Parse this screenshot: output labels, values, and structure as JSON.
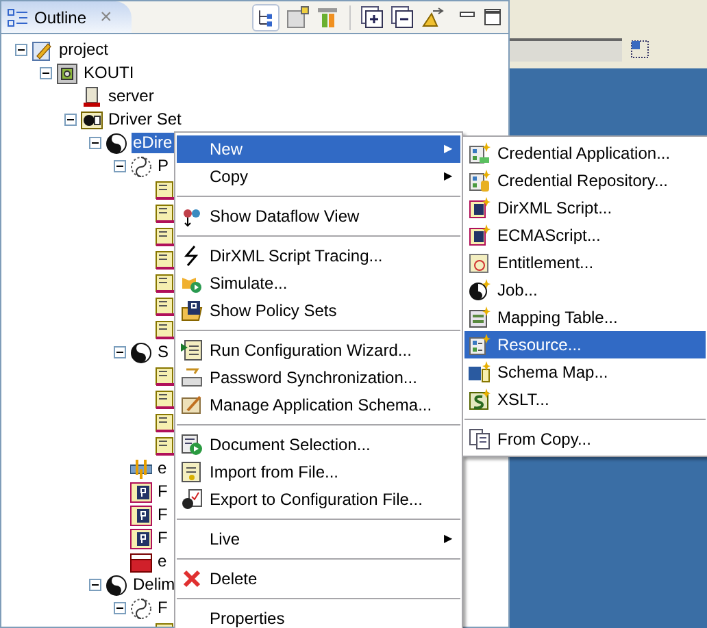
{
  "panel": {
    "title": "Outline",
    "close": "×"
  },
  "tree": [
    {
      "label": "project",
      "kind": "project",
      "expanded": true,
      "children": [
        {
          "label": "KOUTI",
          "kind": "vault",
          "expanded": true,
          "children": [
            {
              "label": "server",
              "kind": "server"
            },
            {
              "label": "Driver Set",
              "kind": "driverset",
              "expanded": true,
              "children": [
                {
                  "label": "eDire",
                  "kind": "driver",
                  "selected": true,
                  "expanded": true,
                  "children": [
                    {
                      "label": "P",
                      "kind": "policyset",
                      "expanded": true,
                      "children": [
                        {
                          "kind": "policy"
                        },
                        {
                          "kind": "policy"
                        },
                        {
                          "kind": "policy"
                        },
                        {
                          "kind": "policy"
                        },
                        {
                          "kind": "policy"
                        },
                        {
                          "kind": "policy"
                        },
                        {
                          "kind": "policy"
                        }
                      ]
                    },
                    {
                      "label": "S",
                      "kind": "driver",
                      "expanded": true,
                      "children": [
                        {
                          "kind": "policy"
                        },
                        {
                          "kind": "policy"
                        },
                        {
                          "kind": "policy"
                        },
                        {
                          "kind": "policy"
                        }
                      ]
                    },
                    {
                      "label": "e",
                      "kind": "filter"
                    },
                    {
                      "label": "F",
                      "kind": "pdoc"
                    },
                    {
                      "label": "F",
                      "kind": "pdoc"
                    },
                    {
                      "label": "F",
                      "kind": "pdoc"
                    },
                    {
                      "label": "e",
                      "kind": "schema"
                    }
                  ]
                },
                {
                  "label": "Delim",
                  "kind": "driver",
                  "selected": false,
                  "expanded": true,
                  "children": [
                    {
                      "label": "F",
                      "kind": "policyset",
                      "expanded": true,
                      "children": [
                        {
                          "kind": "policy"
                        }
                      ]
                    }
                  ]
                }
              ]
            }
          ]
        }
      ]
    }
  ],
  "menu": [
    {
      "kind": "submenu",
      "label": "New",
      "selected": true,
      "arrow": "▶"
    },
    {
      "kind": "submenu",
      "label": "Copy",
      "selected": false,
      "arrow": "▶"
    },
    {
      "kind": "separator"
    },
    {
      "kind": "item",
      "label": "Show Dataflow View",
      "selected": false
    },
    {
      "kind": "separator"
    },
    {
      "kind": "item",
      "label": "DirXML Script Tracing...",
      "selected": false
    },
    {
      "kind": "item",
      "label": "Simulate...",
      "selected": false
    },
    {
      "kind": "item",
      "label": "Show Policy Sets",
      "selected": false
    },
    {
      "kind": "separator"
    },
    {
      "kind": "item",
      "label": "Run Configuration Wizard...",
      "selected": false
    },
    {
      "kind": "item",
      "label": "Password Synchronization...",
      "selected": false
    },
    {
      "kind": "item",
      "label": "Manage Application Schema...",
      "selected": false
    },
    {
      "kind": "separator"
    },
    {
      "kind": "item",
      "label": "Document Selection...",
      "selected": false
    },
    {
      "kind": "item",
      "label": "Import from File...",
      "selected": false
    },
    {
      "kind": "item",
      "label": "Export to Configuration File...",
      "selected": false
    },
    {
      "kind": "separator"
    },
    {
      "kind": "submenu",
      "label": "Live",
      "selected": false,
      "arrow": "▶"
    },
    {
      "kind": "separator"
    },
    {
      "kind": "item",
      "label": "Delete",
      "selected": false
    },
    {
      "kind": "separator"
    },
    {
      "kind": "item",
      "label": "Properties",
      "selected": false
    }
  ],
  "submenu": [
    {
      "kind": "item",
      "label": "Credential Application...",
      "selected": false
    },
    {
      "kind": "item",
      "label": "Credential Repository...",
      "selected": false
    },
    {
      "kind": "item",
      "label": "DirXML Script...",
      "selected": false
    },
    {
      "kind": "item",
      "label": "ECMAScript...",
      "selected": false
    },
    {
      "kind": "item",
      "label": "Entitlement...",
      "selected": false
    },
    {
      "kind": "item",
      "label": "Job...",
      "selected": false
    },
    {
      "kind": "item",
      "label": "Mapping Table...",
      "selected": false
    },
    {
      "kind": "item",
      "label": "Resource...",
      "selected": true
    },
    {
      "kind": "item",
      "label": "Schema Map...",
      "selected": false
    },
    {
      "kind": "item",
      "label": "XSLT...",
      "selected": false
    },
    {
      "kind": "separator"
    },
    {
      "kind": "item",
      "label": "From Copy...",
      "selected": false
    }
  ]
}
